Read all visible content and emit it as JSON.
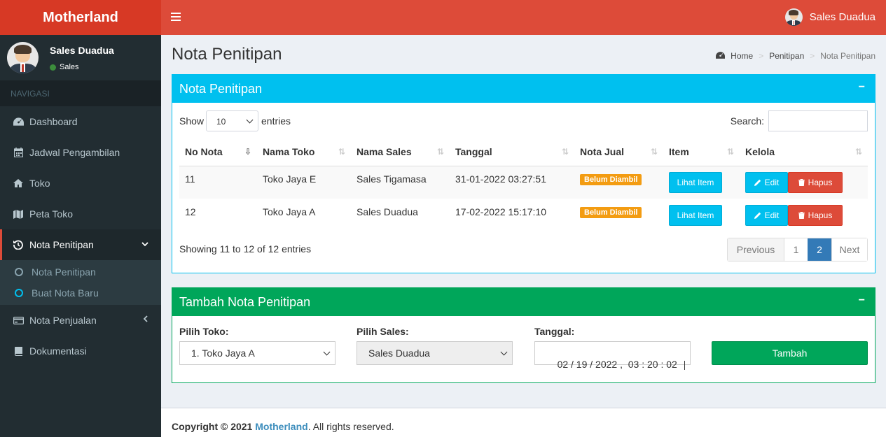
{
  "app": {
    "logo": "Motherland"
  },
  "header": {
    "user_name": "Sales Duadua"
  },
  "sidebar": {
    "user": {
      "name": "Sales Duadua",
      "status": "Sales"
    },
    "nav_header": "NAVIGASI",
    "items": [
      {
        "label": "Dashboard",
        "icon": "dashboard-icon"
      },
      {
        "label": "Jadwal Pengambilan",
        "icon": "calendar-icon"
      },
      {
        "label": "Toko",
        "icon": "home-icon"
      },
      {
        "label": "Peta Toko",
        "icon": "map-icon"
      },
      {
        "label": "Nota Penitipan",
        "icon": "history-icon"
      },
      {
        "label": "Nota Penjualan",
        "icon": "credit-card-icon"
      },
      {
        "label": "Dokumentasi",
        "icon": "book-icon"
      }
    ],
    "submenu": [
      {
        "label": "Nota Penitipan"
      },
      {
        "label": "Buat Nota Baru"
      }
    ]
  },
  "page": {
    "title": "Nota Penitipan",
    "breadcrumb": [
      "Home",
      "Penitipan",
      "Nota Penitipan"
    ]
  },
  "box_list": {
    "title": "Nota Penitipan",
    "show_label": "Show",
    "length_value": "10",
    "entries_label": "entries",
    "search_label": "Search:",
    "columns": [
      "No Nota",
      "Nama Toko",
      "Nama Sales",
      "Tanggal",
      "Nota Jual",
      "Item",
      "Kelola"
    ],
    "rows": [
      {
        "no": "11",
        "toko": "Toko Jaya E",
        "sales": "Sales Tigamasa",
        "tanggal": "31-01-2022 03:27:51",
        "nota_jual": "Belum Diambil"
      },
      {
        "no": "12",
        "toko": "Toko Jaya A",
        "sales": "Sales Duadua",
        "tanggal": "17-02-2022 15:17:10",
        "nota_jual": "Belum Diambil"
      }
    ],
    "btn_item": "Lihat Item",
    "btn_edit": "Edit",
    "btn_delete": "Hapus",
    "info": "Showing 11 to 12 of 12 entries",
    "pagination": {
      "previous": "Previous",
      "pages": [
        "1",
        "2"
      ],
      "current": "2",
      "next": "Next"
    }
  },
  "box_form": {
    "title": "Tambah Nota Penitipan",
    "toko_label": "Pilih Toko:",
    "toko_value": "1. Toko Jaya A",
    "sales_label": "Pilih Sales:",
    "sales_value": "Sales Duadua",
    "tanggal_label": "Tanggal:",
    "tanggal_value": "02 / 19 / 2022 ,  03 : 20 : 02",
    "submit": "Tambah"
  },
  "footer": {
    "prefix": "Copyright © 2021",
    "brand": "Motherland",
    "suffix": ". All rights reserved."
  },
  "colors": {
    "red": "#dd4b39",
    "aqua": "#00c0ef",
    "green": "#00a65a",
    "sidebar": "#222d32",
    "primary": "#337ab7"
  }
}
